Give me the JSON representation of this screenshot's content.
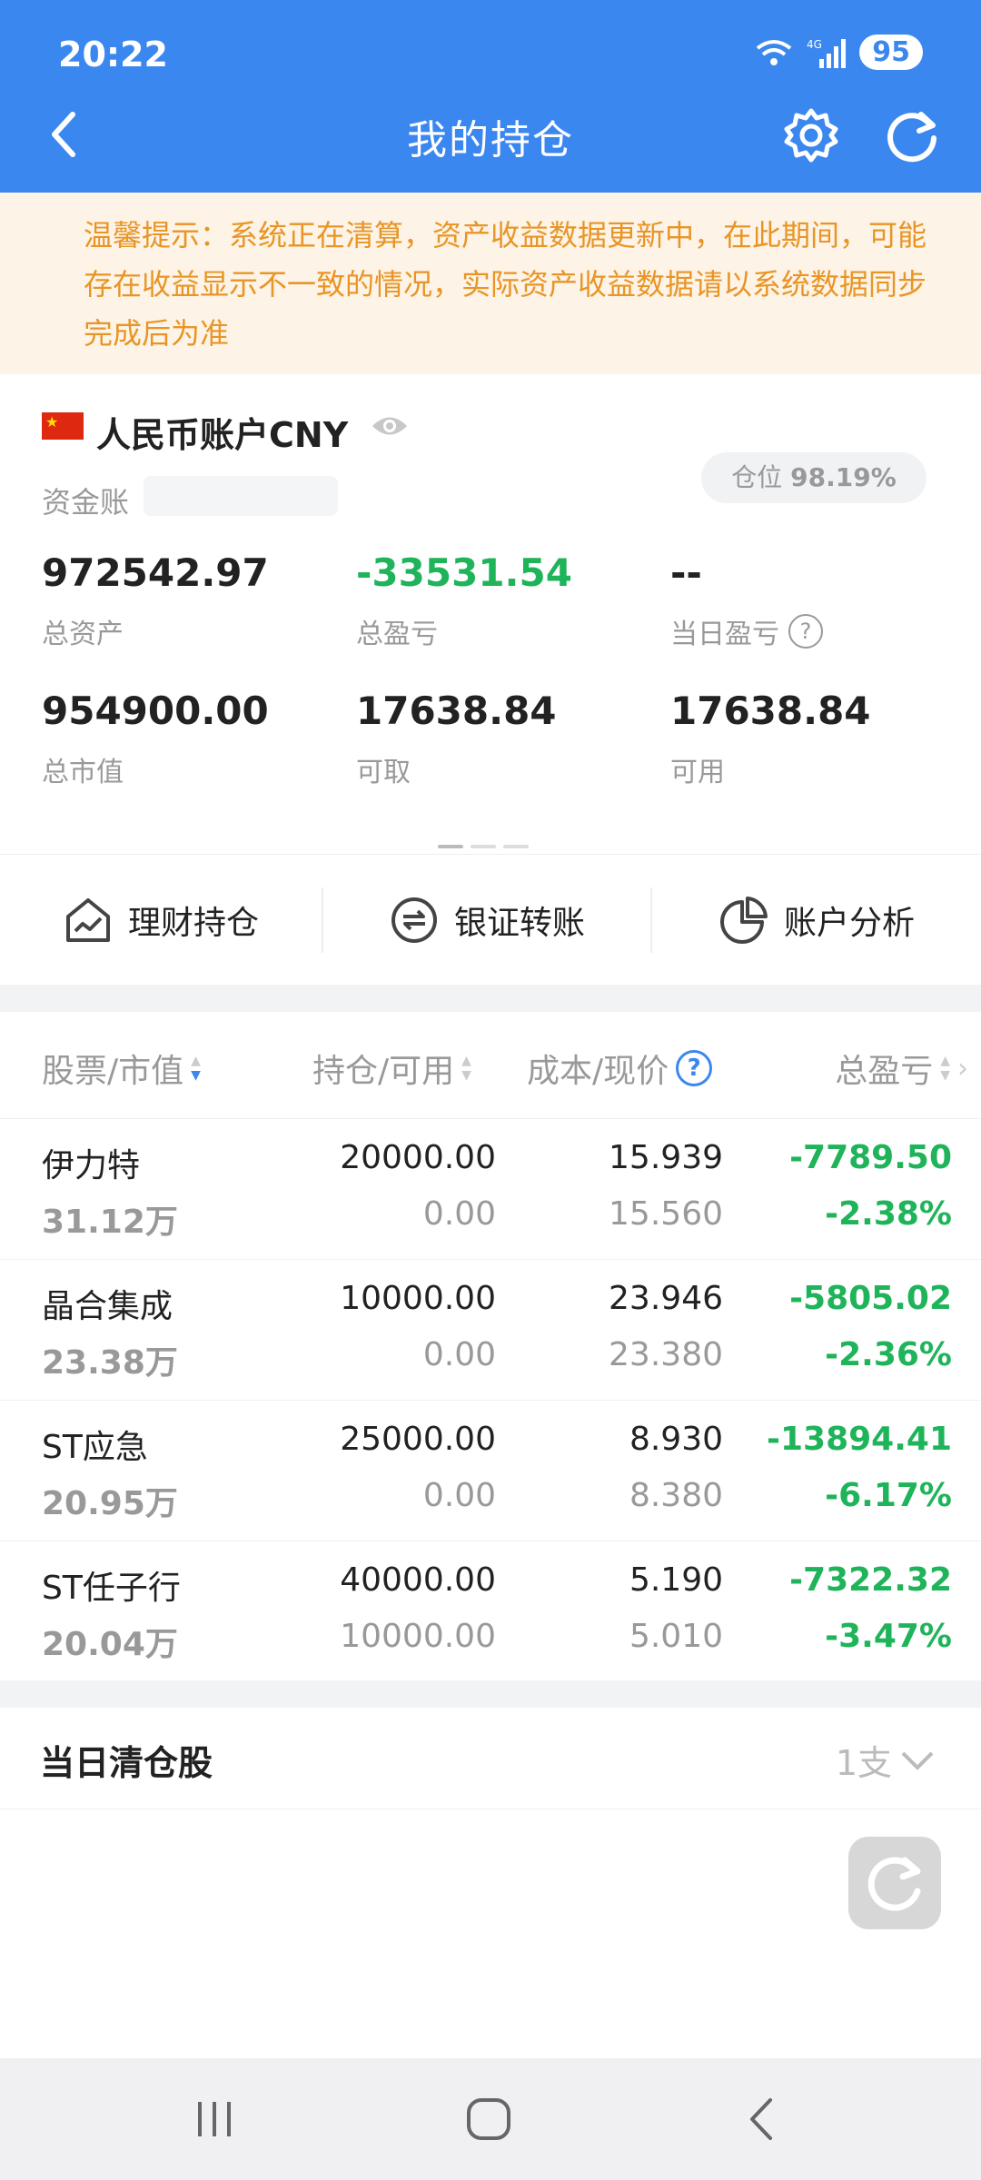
{
  "status_bar": {
    "time": "20:22",
    "battery": "95",
    "network": "4G"
  },
  "header": {
    "title": "我的持仓"
  },
  "notice": {
    "text": "温馨提示：系统正在清算，资产收益数据更新中，在此期间，可能存在收益显示不一致的情况，实际资产收益数据请以系统数据同步完成后为准"
  },
  "account": {
    "name": "人民币账户CNY",
    "capital_label": "资金账",
    "position_label": "仓位",
    "position_value": "98.19%",
    "metrics": [
      {
        "value": "972542.97",
        "label": "总资产"
      },
      {
        "value": "-33531.54",
        "label": "总盈亏"
      },
      {
        "value": "--",
        "label": "当日盈亏"
      },
      {
        "value": "954900.00",
        "label": "总市值"
      },
      {
        "value": "17638.84",
        "label": "可取"
      },
      {
        "value": "17638.84",
        "label": "可用"
      }
    ]
  },
  "shortcuts": [
    {
      "label": "理财持仓",
      "icon": "chart-house-icon"
    },
    {
      "label": "银证转账",
      "icon": "transfer-icon"
    },
    {
      "label": "账户分析",
      "icon": "pie-chart-icon"
    }
  ],
  "table": {
    "headers": {
      "stock": "股票/市值",
      "hold": "持仓/可用",
      "cost": "成本/现价",
      "pnl": "总盈亏"
    },
    "rows": [
      {
        "name": "伊力特",
        "market_value": "31.12万",
        "hold": "20000.00",
        "available": "0.00",
        "cost": "15.939",
        "price": "15.560",
        "pnl": "-7789.50",
        "pnl_pct": "-2.38%"
      },
      {
        "name": "晶合集成",
        "market_value": "23.38万",
        "hold": "10000.00",
        "available": "0.00",
        "cost": "23.946",
        "price": "23.380",
        "pnl": "-5805.02",
        "pnl_pct": "-2.36%"
      },
      {
        "name": "ST应急",
        "market_value": "20.95万",
        "hold": "25000.00",
        "available": "0.00",
        "cost": "8.930",
        "price": "8.380",
        "pnl": "-13894.41",
        "pnl_pct": "-6.17%"
      },
      {
        "name": "ST任子行",
        "market_value": "20.04万",
        "hold": "40000.00",
        "available": "10000.00",
        "cost": "5.190",
        "price": "5.010",
        "pnl": "-7322.32",
        "pnl_pct": "-3.47%"
      }
    ]
  },
  "cleared": {
    "title": "当日清仓股",
    "count": "1支"
  },
  "colors": {
    "brand": "#3b87f0",
    "loss": "#1fb45a",
    "notice": "#e89525"
  }
}
